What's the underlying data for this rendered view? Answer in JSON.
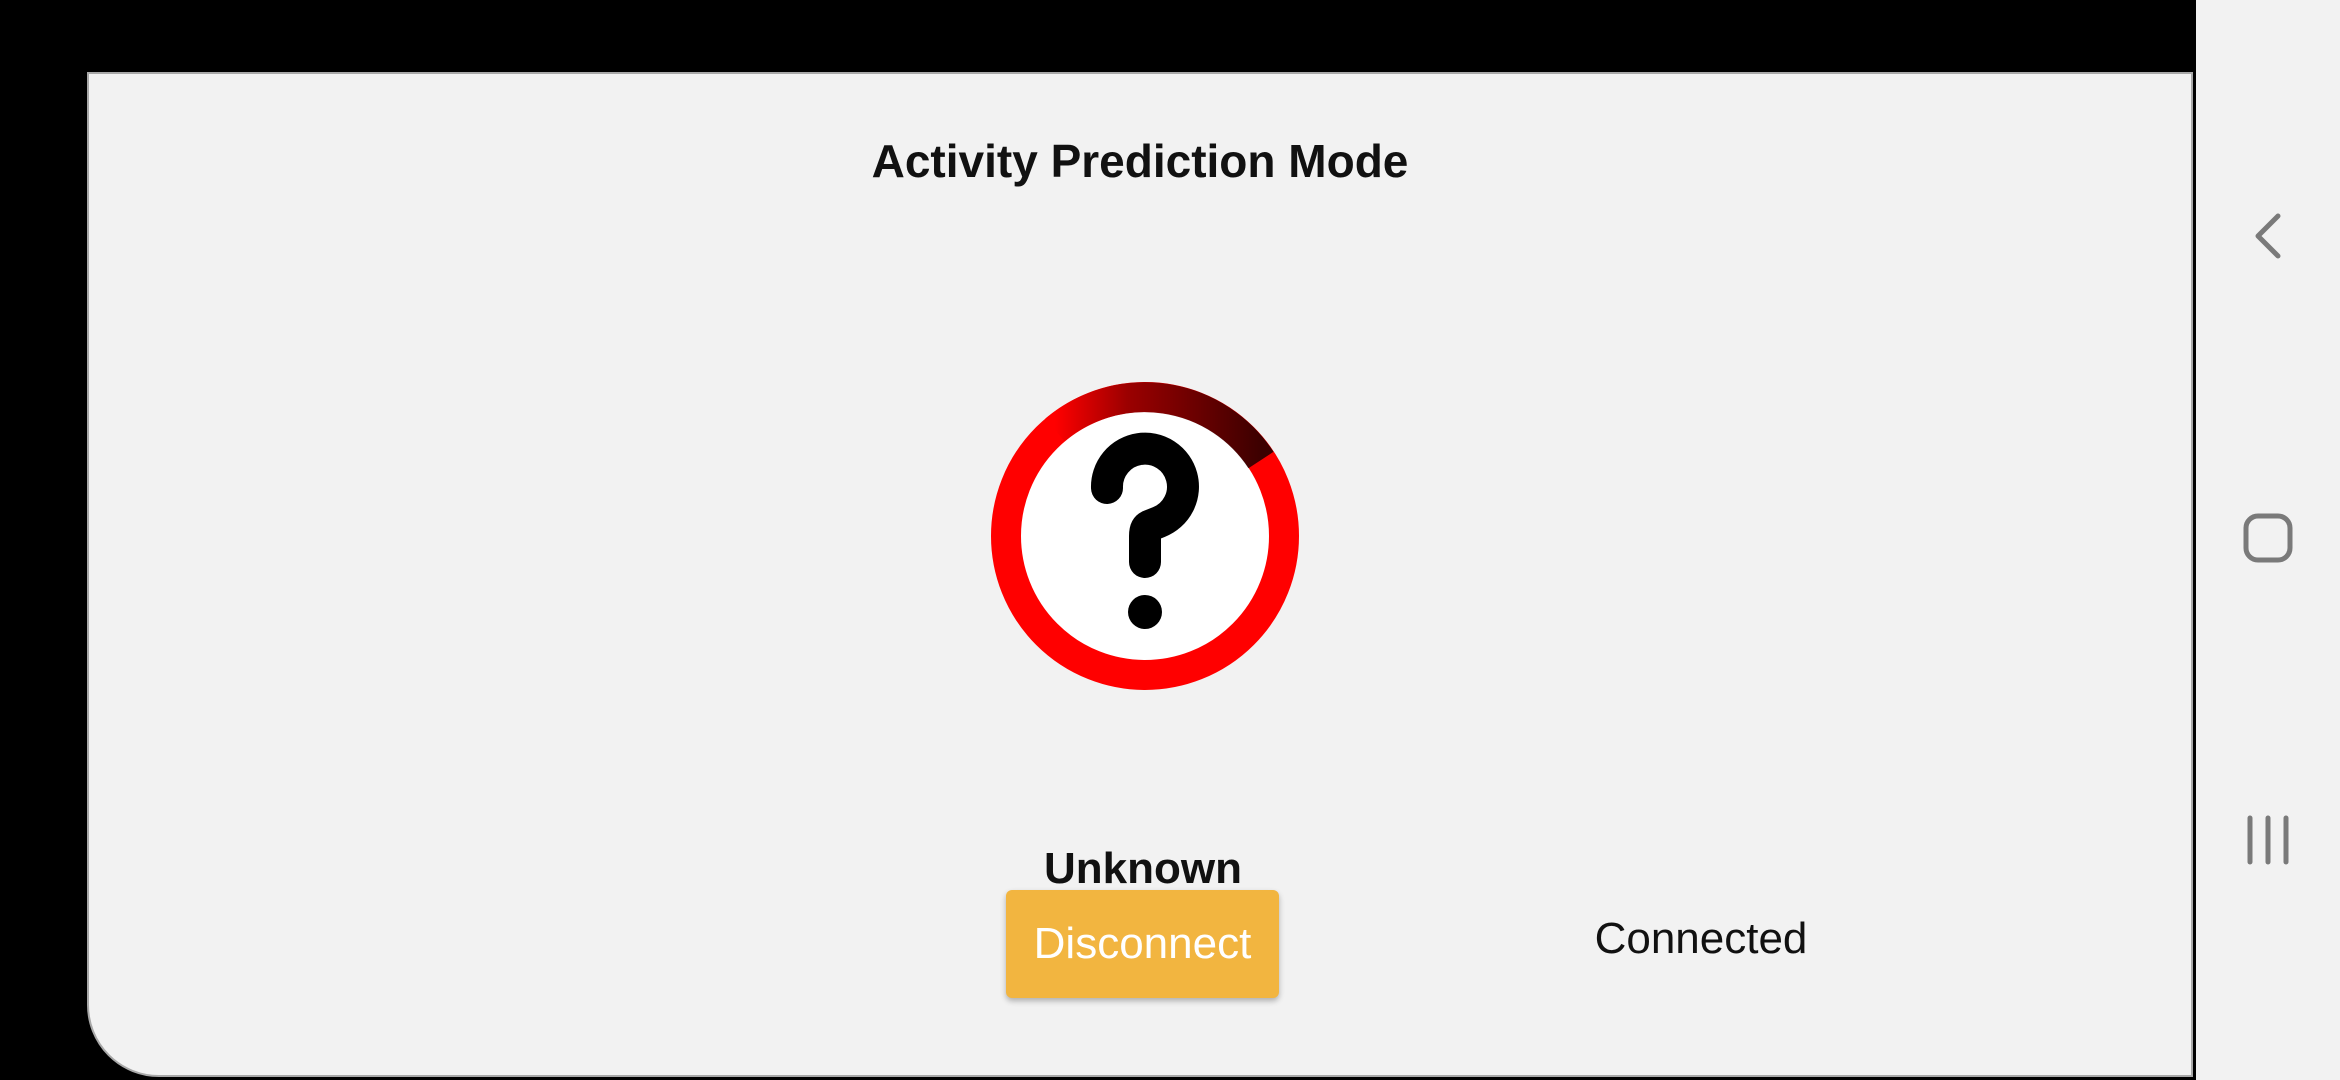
{
  "screen": {
    "title": "Activity Prediction Mode",
    "activity": {
      "label": "Unknown",
      "icon": "question-mark-icon",
      "ring_color": "#ff0000",
      "ring_dark_color": "#7a0000"
    },
    "disconnect_label": "Disconnect",
    "connection_status": "Connected",
    "accent_color": "#f2b540"
  },
  "nav_bar": {
    "back_icon": "back-icon",
    "home_icon": "home-icon",
    "recents_icon": "recents-icon"
  }
}
